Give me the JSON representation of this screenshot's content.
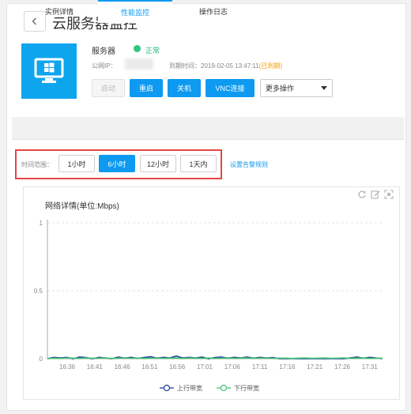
{
  "header": {
    "title": "云服务器监控"
  },
  "server": {
    "name_label": "服务器",
    "status": "正常",
    "ip_label": "公网IP：",
    "expire_label": "到期时间：2019-02-05 13:47:11",
    "expire_tag": "(已到期)"
  },
  "actions": {
    "start": "启动",
    "restart": "重启",
    "shutdown": "关机",
    "vnc": "VNC连接",
    "more": "更多操作"
  },
  "tabs": [
    {
      "label": "实例详情"
    },
    {
      "label": "性能监控"
    },
    {
      "label": "操作日志"
    }
  ],
  "time_range": {
    "label": "时间范围：",
    "options": [
      "1小时",
      "6小时",
      "12小时",
      "1天内"
    ],
    "selected": "6小时"
  },
  "alarm_link": "设置告警规则",
  "chart_data": {
    "type": "line",
    "title": "网络详情(单位:Mbps)",
    "ylim": [
      0,
      1
    ],
    "y_ticks": [
      "0",
      "0.5",
      "1"
    ],
    "x_ticks": [
      "16:36",
      "16:41",
      "16:46",
      "16:51",
      "16:56",
      "17:01",
      "17:06",
      "17:11",
      "17:16",
      "17:21",
      "17:26",
      "17:31"
    ],
    "series": [
      {
        "name": "上行带宽",
        "color": "#1b3f9c",
        "values": [
          0.0,
          0.01,
          0.005,
          0.01,
          0.0,
          0.012,
          0.008,
          0.0,
          0.01,
          0.006,
          0.0,
          0.012,
          0.004,
          0.01,
          0.003,
          0.009,
          0.015,
          0.004,
          0.01,
          0.006,
          0.02,
          0.005,
          0.01,
          0.005,
          0.012,
          0.0,
          0.008,
          0.012,
          0.004,
          0.01,
          0.006,
          0.012,
          0.004,
          0.01,
          0.005,
          0.008,
          0.0,
          0.0,
          0.0,
          0.0,
          0.0,
          0.0,
          0.0,
          0.0,
          0.0,
          0.0,
          0.0,
          0.006,
          0.012,
          0.004,
          0.01,
          0.006,
          0.0
        ]
      },
      {
        "name": "下行带宽",
        "color": "#3fc46f",
        "values": [
          0.0,
          0.004,
          0.002,
          0.006,
          0.004,
          0.002,
          0.006,
          0.003,
          0.004,
          0.006,
          0.002,
          0.004,
          0.006,
          0.003,
          0.005,
          0.002,
          0.004,
          0.006,
          0.003,
          0.004,
          0.005,
          0.002,
          0.006,
          0.004,
          0.003,
          0.005,
          0.002,
          0.004,
          0.006,
          0.003,
          0.004,
          0.005,
          0.003,
          0.004,
          0.006,
          0.003,
          0.004,
          0.004,
          0.002,
          0.004,
          0.005,
          0.003,
          0.004,
          0.005,
          0.003,
          0.004,
          0.006,
          0.003,
          0.004,
          0.005,
          0.002,
          0.004,
          0.003
        ]
      }
    ]
  }
}
